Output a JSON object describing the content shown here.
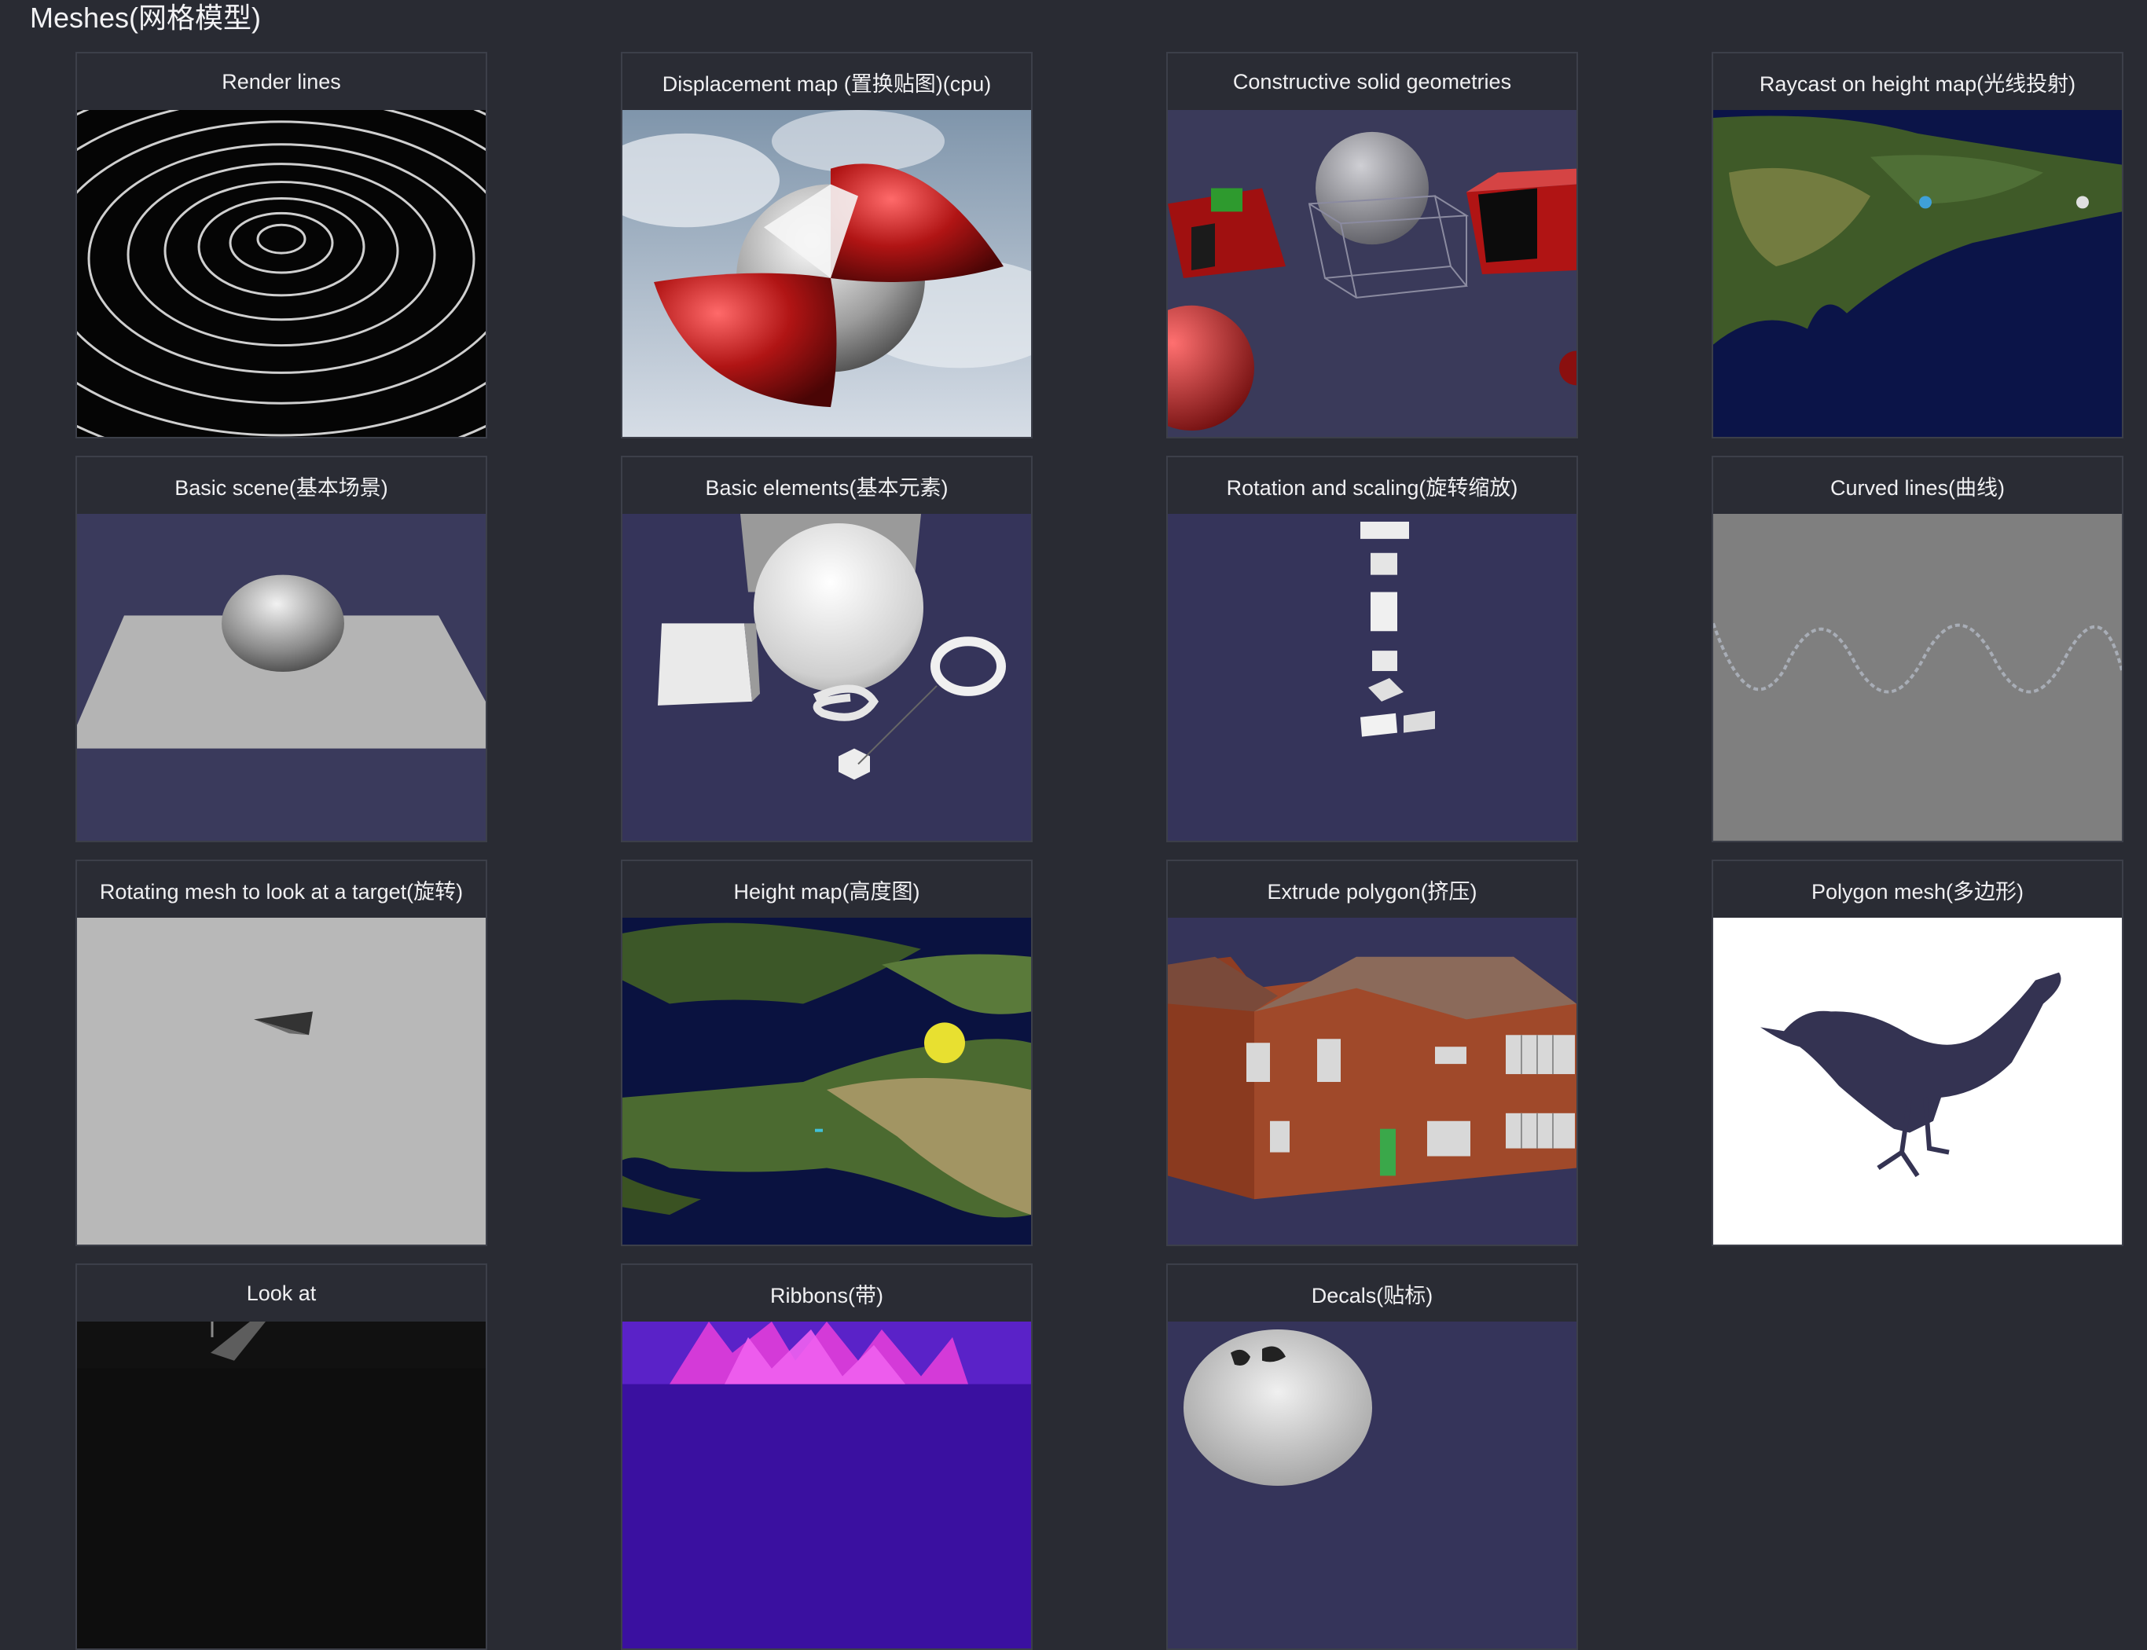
{
  "section": {
    "title": "Meshes(网格模型)"
  },
  "examples": [
    {
      "title": "Render lines",
      "thumb": "render-lines-thumbnail"
    },
    {
      "title": "Displacement map (置换贴图)(cpu)",
      "thumb": "displacement-map-thumbnail"
    },
    {
      "title": "Constructive solid geometries",
      "thumb": "csg-thumbnail"
    },
    {
      "title": "Raycast on height map(光线投射)",
      "thumb": "raycast-height-map-thumbnail"
    },
    {
      "title": "Basic scene(基本场景)",
      "thumb": "basic-scene-thumbnail"
    },
    {
      "title": "Basic elements(基本元素)",
      "thumb": "basic-elements-thumbnail"
    },
    {
      "title": "Rotation and scaling(旋转缩放)",
      "thumb": "rotation-scaling-thumbnail"
    },
    {
      "title": "Curved lines(曲线)",
      "thumb": "curved-lines-thumbnail"
    },
    {
      "title": "Rotating mesh to look at a target(旋转)",
      "thumb": "rotating-mesh-thumbnail"
    },
    {
      "title": "Height map(高度图)",
      "thumb": "height-map-thumbnail"
    },
    {
      "title": "Extrude polygon(挤压)",
      "thumb": "extrude-polygon-thumbnail"
    },
    {
      "title": "Polygon mesh(多边形)",
      "thumb": "polygon-mesh-thumbnail"
    },
    {
      "title": "Look at",
      "thumb": "look-at-thumbnail"
    },
    {
      "title": "Ribbons(带)",
      "thumb": "ribbons-thumbnail"
    },
    {
      "title": "Decals(贴标)",
      "thumb": "decals-thumbnail"
    }
  ]
}
